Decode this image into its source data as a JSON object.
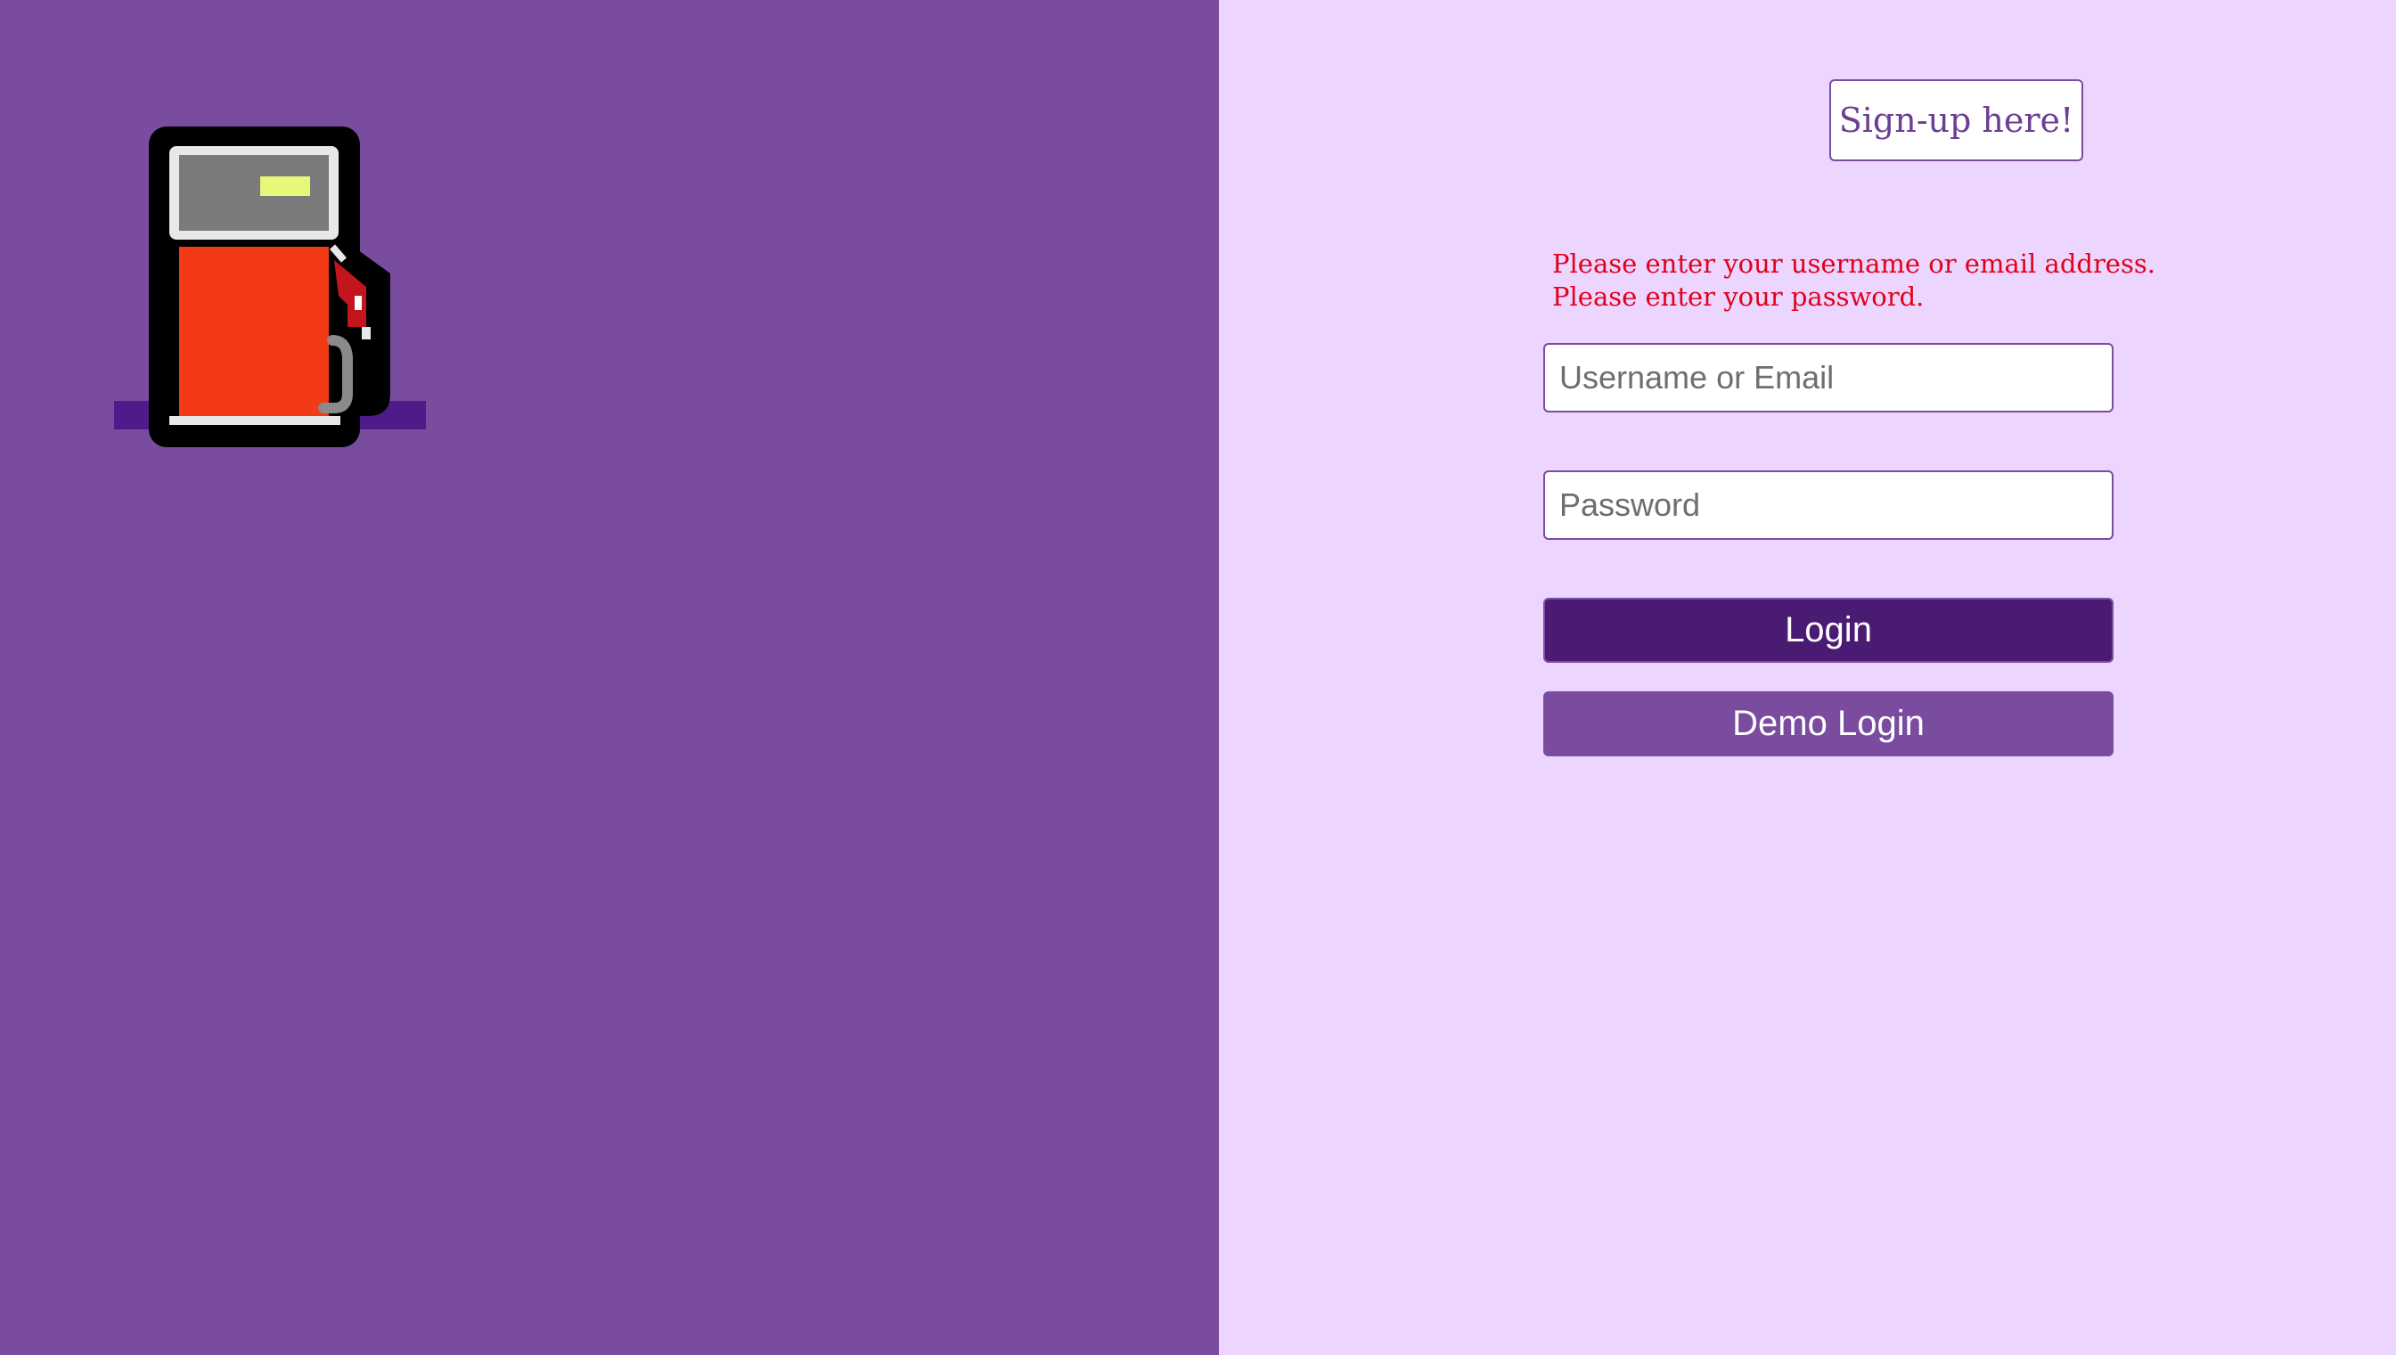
{
  "logo": {
    "icon": "fuel-pump-icon"
  },
  "header": {
    "signup_label": "Sign-up here!"
  },
  "form": {
    "errors": [
      "Please enter your username or email address.",
      "Please enter your password."
    ],
    "username": {
      "placeholder": "Username or Email",
      "value": ""
    },
    "password": {
      "placeholder": "Password",
      "value": ""
    },
    "login_label": "Login",
    "demo_login_label": "Demo Login"
  },
  "colors": {
    "left_panel": "#794c9f",
    "right_panel": "#ecd5fe",
    "login_button": "#4a1b73",
    "demo_button": "#794c9f",
    "error_text": "#e3001b",
    "signup_text": "#6b3f94"
  }
}
